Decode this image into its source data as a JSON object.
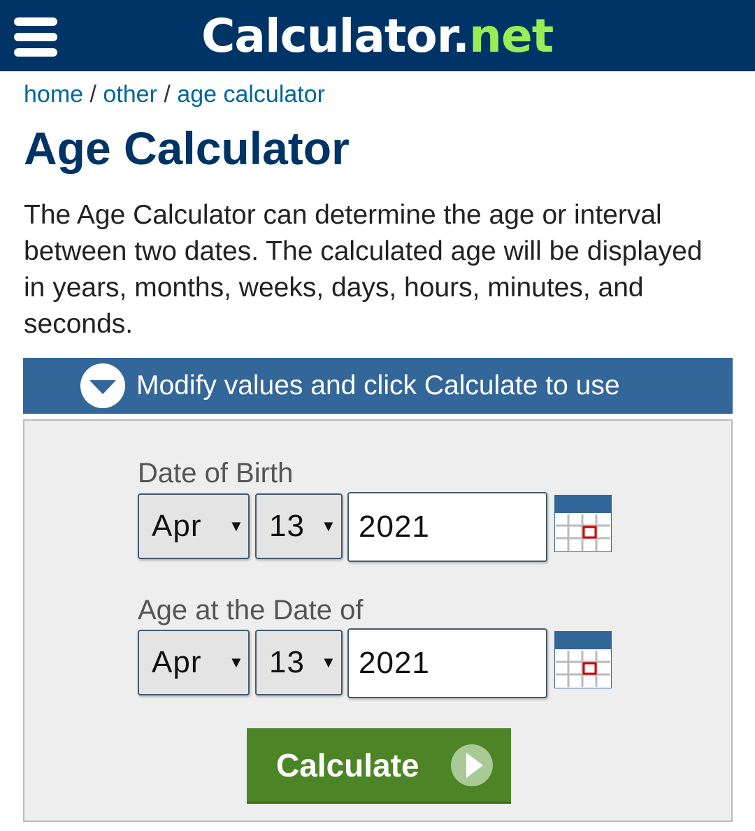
{
  "header": {
    "logo_part1": "Calculator",
    "logo_part2": ".",
    "logo_part3": "net",
    "menu_icon": "hamburger-menu-icon"
  },
  "breadcrumb": {
    "items": [
      "home",
      "other",
      "age calculator"
    ],
    "separator": "/"
  },
  "page": {
    "title": "Age Calculator",
    "description": "The Age Calculator can determine the age or interval between two dates. The calculated age will be displayed in years, months, weeks, days, hours, minutes, and seconds."
  },
  "banner": {
    "text": "Modify values and click Calculate to use",
    "icon": "chevron-down-circle-icon"
  },
  "form": {
    "birth": {
      "label": "Date of Birth",
      "month": "Apr",
      "day": "13",
      "year": "2021"
    },
    "at_date": {
      "label": "Age at the Date of",
      "month": "Apr",
      "day": "13",
      "year": "2021"
    },
    "caret": "▼",
    "calendar_icon": "calendar-icon",
    "calculate_label": "Calculate",
    "calculate_icon": "play-circle-icon"
  },
  "colors": {
    "header_bg": "#003366",
    "logo_accent": "#99ee55",
    "link": "#006699",
    "banner_bg": "#336699",
    "button_bg": "#4d8526",
    "panel_bg": "#eeeeee"
  }
}
